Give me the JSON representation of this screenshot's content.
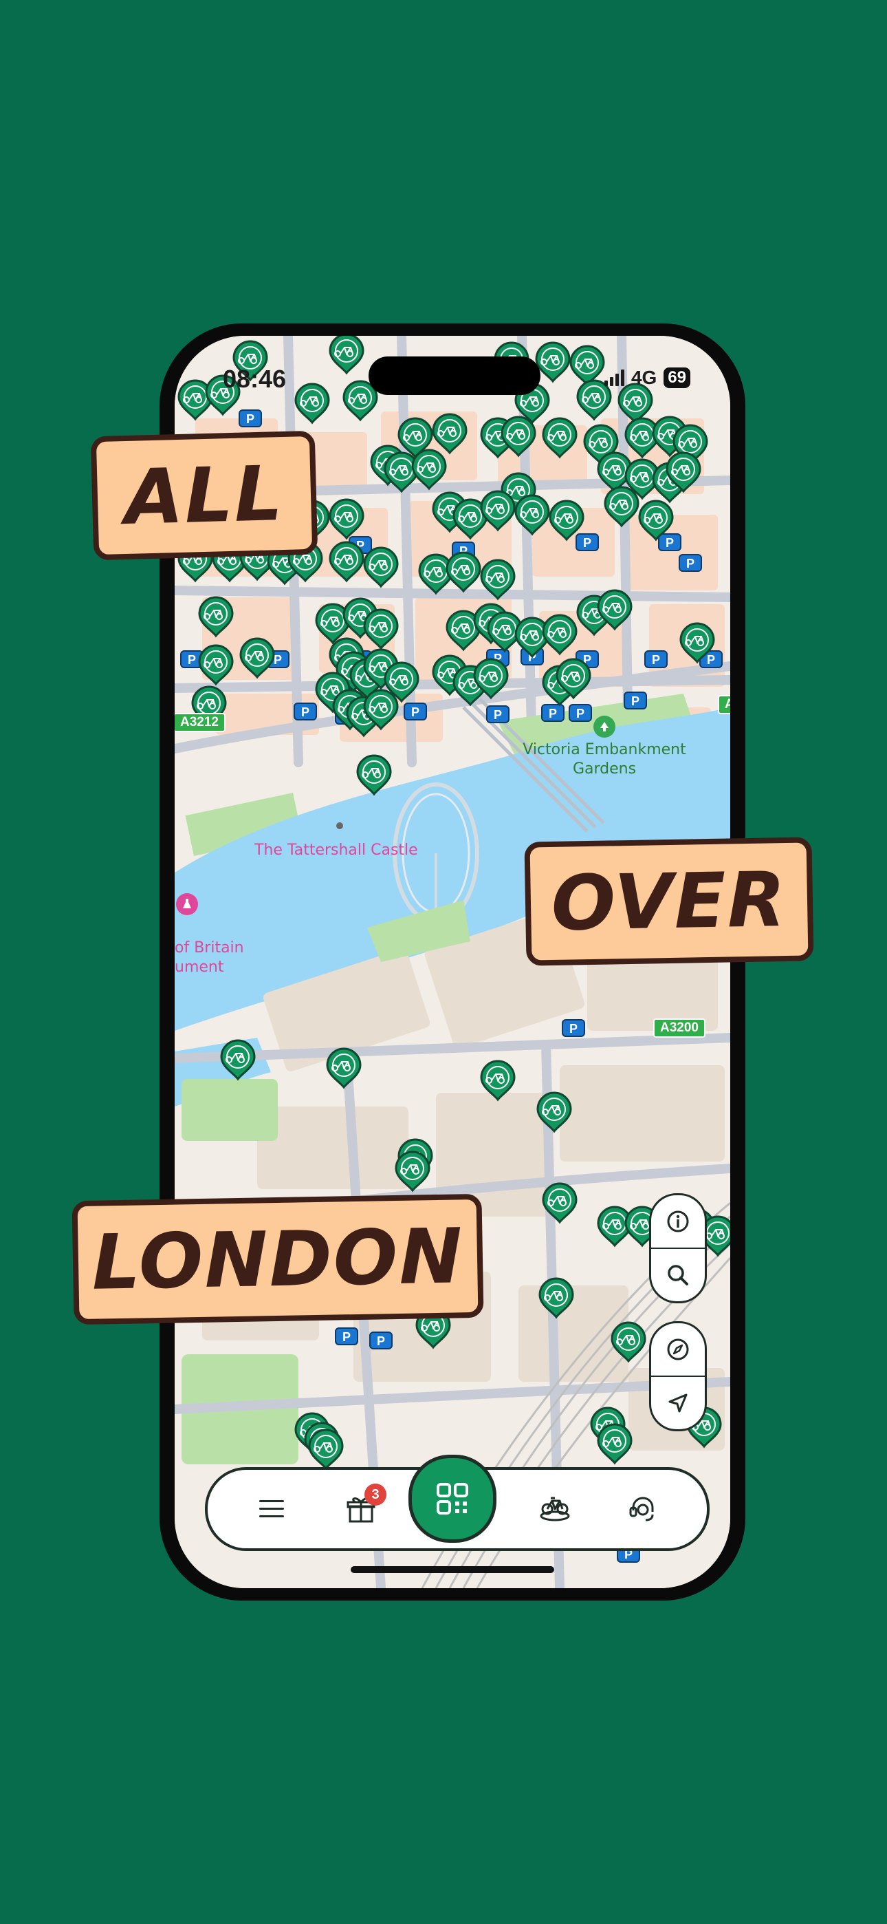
{
  "status_bar": {
    "time": "08:46",
    "network": "4G",
    "battery": "69"
  },
  "stickers": {
    "line1": "ALL",
    "line2": "OVER",
    "line3": "LONDON"
  },
  "map_labels": {
    "park": "Victoria Embankment Gardens",
    "attraction": "The Tattershall Castle",
    "monument": "of Britain\nument",
    "road_left": "A3212",
    "road_right": "A3200",
    "road_edge": "A"
  },
  "map_controls": [
    "info-icon",
    "search-icon",
    "compass-icon",
    "locate-icon"
  ],
  "tab_bar": {
    "items": [
      "menu-icon",
      "gift-icon",
      "scan-icon",
      "bike-icon",
      "support-icon"
    ],
    "gift_badge": "3"
  },
  "colors": {
    "background": "#066c4b",
    "pin": "#11965e",
    "sticker_fill": "#fccb99",
    "sticker_text": "#3d1f18",
    "water": "#9ad6f5",
    "parking": "#1976d2"
  }
}
